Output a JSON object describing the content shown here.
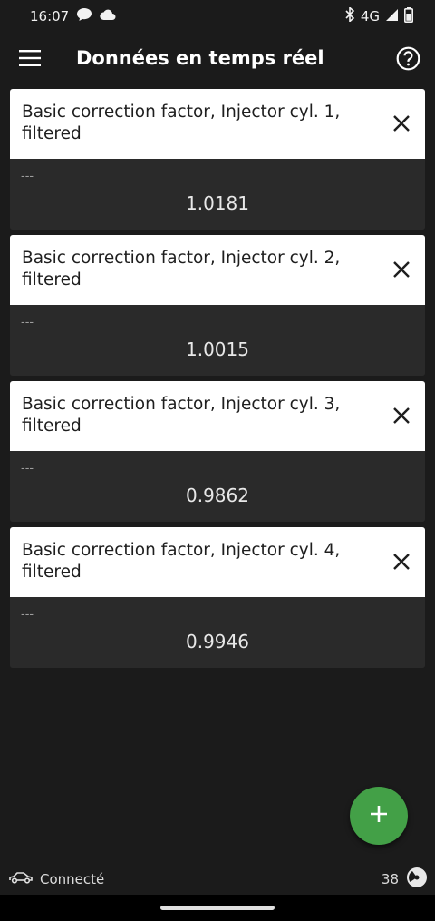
{
  "status_bar": {
    "time": "16:07",
    "network": "4G"
  },
  "app_bar": {
    "title": "Données en temps réel"
  },
  "cards": [
    {
      "title": "Basic correction factor, Injector cyl. 1, filtered",
      "subtitle": "---",
      "value": "1.0181"
    },
    {
      "title": "Basic correction factor, Injector cyl. 2, filtered",
      "subtitle": "---",
      "value": "1.0015"
    },
    {
      "title": "Basic correction factor, Injector cyl. 3, filtered",
      "subtitle": "---",
      "value": "0.9862"
    },
    {
      "title": "Basic correction factor, Injector cyl. 4, filtered",
      "subtitle": "---",
      "value": "0.9946"
    }
  ],
  "bottom_bar": {
    "connection_status": "Connecté",
    "count": "38"
  },
  "colors": {
    "background": "#1b1b1b",
    "card_header": "#ffffff",
    "card_body": "#2a2a2a",
    "fab": "#43a047"
  }
}
